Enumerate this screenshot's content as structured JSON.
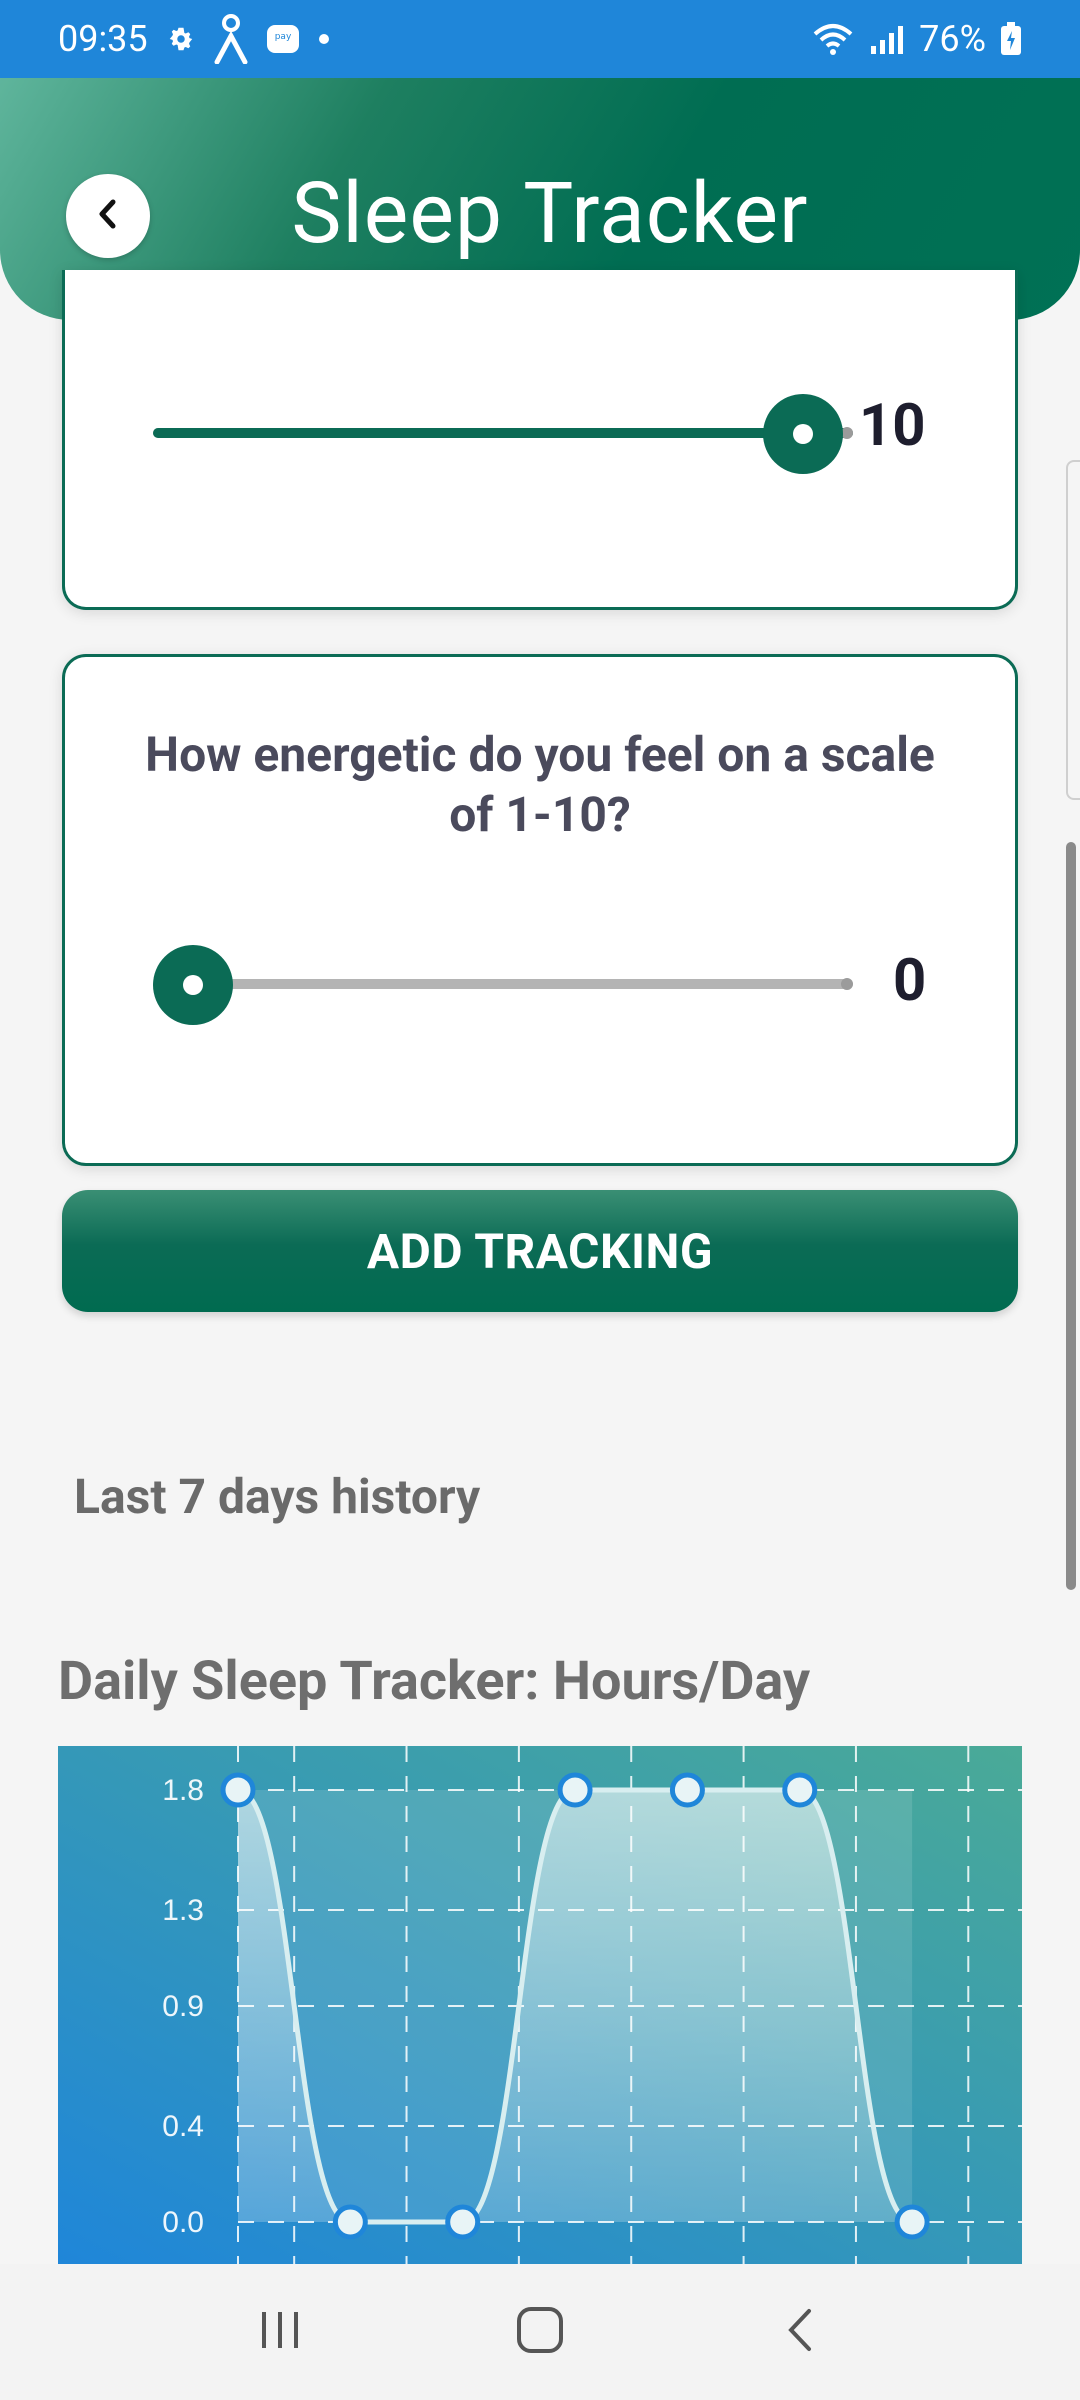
{
  "status_bar": {
    "time": "09:35",
    "battery": "76%",
    "left_icons": [
      "gear-icon",
      "person-icon",
      "pay-icon",
      "dot-icon"
    ],
    "right_icons": [
      "wifi-icon",
      "signal-icon",
      "battery-icon"
    ]
  },
  "header": {
    "title": "Sleep Tracker",
    "back_icon": "chevron-left-icon"
  },
  "cards": [
    {
      "question": "",
      "slider_value": "10",
      "min": 0,
      "max": 10,
      "value": 10
    },
    {
      "question": "How energetic do you feel on a scale of 1-10?",
      "slider_value": "0",
      "min": 0,
      "max": 10,
      "value": 0
    }
  ],
  "add_button": {
    "label": "ADD TRACKING"
  },
  "history": {
    "label": "Last 7 days history"
  },
  "chart_title": "Daily Sleep Tracker: Hours/Day",
  "chart_data": {
    "type": "area",
    "title": "Daily Sleep Tracker: Hours/Day",
    "xlabel": "",
    "ylabel": "",
    "y_ticks": [
      "1.8",
      "1.3",
      "0.9",
      "0.4",
      "0.0"
    ],
    "ylim": [
      0,
      1.8
    ],
    "x": [
      1,
      2,
      3,
      4,
      5,
      6,
      7
    ],
    "values": [
      1.8,
      0.0,
      0.0,
      1.8,
      1.8,
      1.8,
      0.0
    ],
    "grid": true,
    "colors": {
      "background_start": "#1f86d9",
      "background_end": "#4aaa97",
      "line": "#d8eef0",
      "point_border": "#1f86d9"
    }
  },
  "navbar": {
    "icons": [
      "recent-apps-icon",
      "home-icon",
      "back-nav-icon"
    ]
  }
}
